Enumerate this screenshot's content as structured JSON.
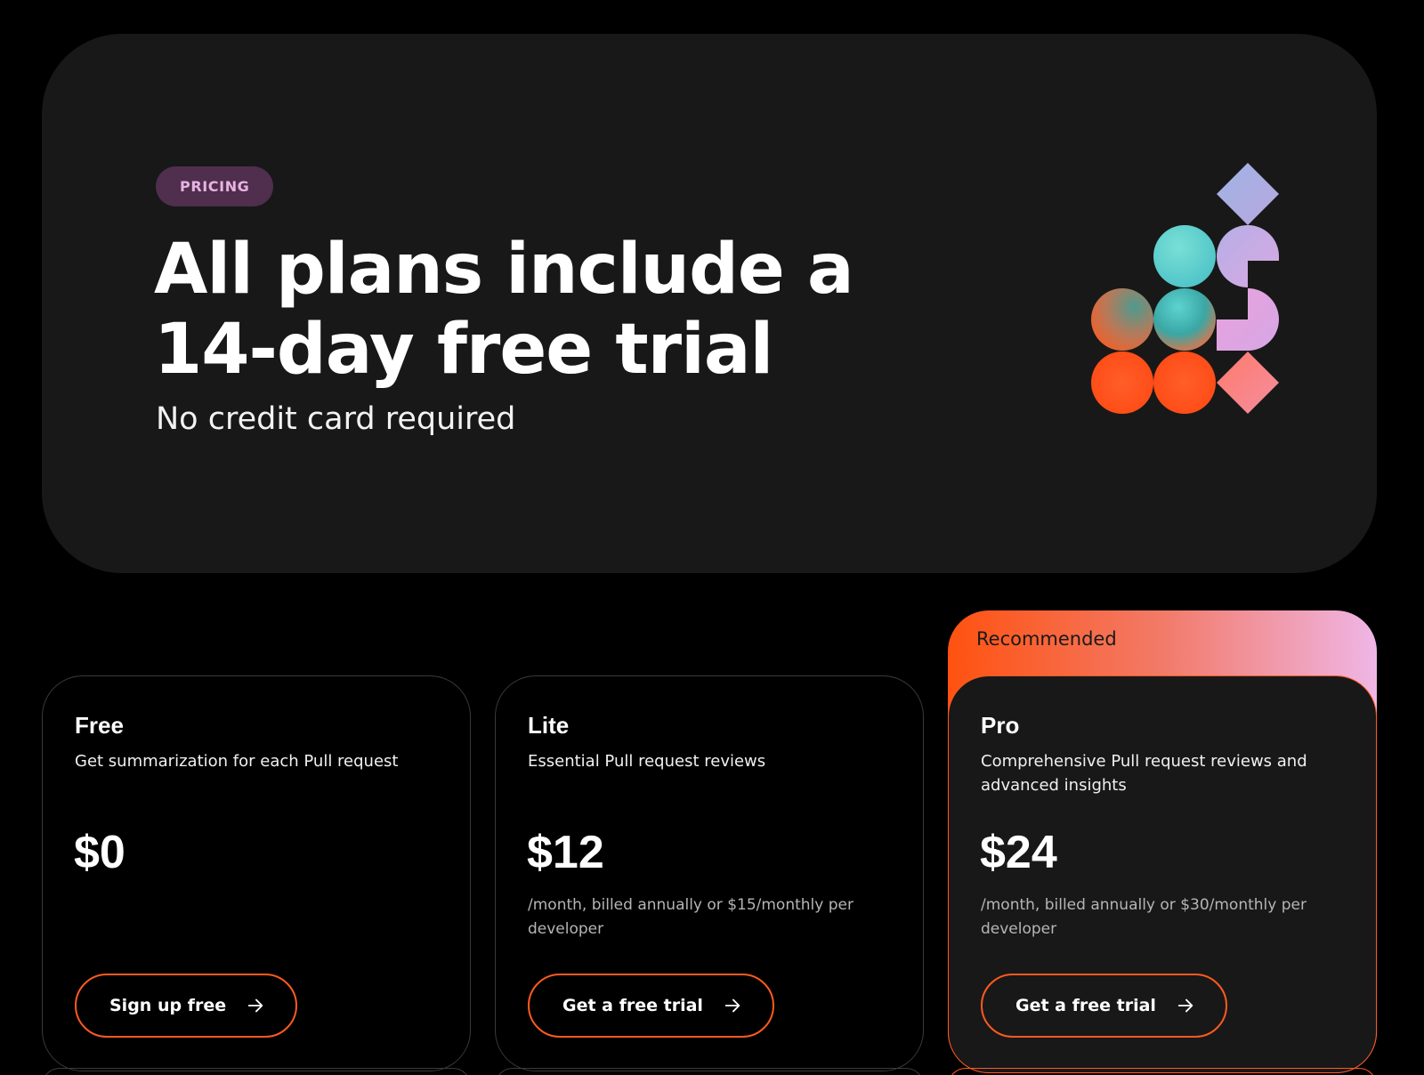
{
  "hero": {
    "badge": "PRICING",
    "headline": "All plans include a 14-day free trial",
    "subhead": "No credit card required"
  },
  "colors": {
    "accent": "#ff5a1f",
    "card_bg": "#181818",
    "badge_bg": "#4f2f4d",
    "badge_text": "#e7b3e3"
  },
  "plans": [
    {
      "name": "Free",
      "description": "Get summarization for each Pull request",
      "price": "$0",
      "note": "",
      "cta": "Sign up free"
    },
    {
      "name": "Lite",
      "description": "Essential Pull request reviews",
      "price": "$12",
      "note": "/month, billed annually or $15/monthly per developer",
      "cta": "Get a free trial"
    },
    {
      "name": "Pro",
      "description": "Comprehensive Pull request reviews and advanced insights",
      "price": "$24",
      "note": "/month, billed annually or $30/monthly per developer",
      "cta": "Get a free trial",
      "recommended_label": "Recommended"
    }
  ],
  "icons": {
    "cta_arrow": "arrow-right-icon"
  }
}
